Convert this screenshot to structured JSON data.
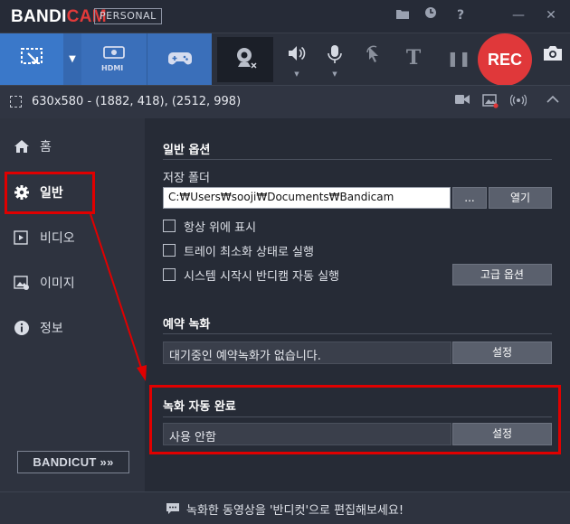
{
  "app": {
    "logo_main": "BANDI",
    "logo_accent": "CAM",
    "edition": "PERSONAL"
  },
  "titlebar": {
    "icons": [
      "folder-icon",
      "clock-icon",
      "help-icon",
      "minimize-icon",
      "close-icon"
    ],
    "minimize": "—",
    "close": "✕"
  },
  "toolbar": {
    "rec_label": "REC",
    "hdmi_label": "HDMI",
    "dd_arrow": "▼",
    "text_tool": "T",
    "pause": "❚❚"
  },
  "infobar": {
    "capture_info": "630x580 - (1882, 418), (2512, 998)"
  },
  "sidebar": {
    "items": [
      {
        "label": "홈",
        "icon": "home-icon"
      },
      {
        "label": "일반",
        "icon": "gear-icon"
      },
      {
        "label": "비디오",
        "icon": "video-icon"
      },
      {
        "label": "이미지",
        "icon": "image-icon"
      },
      {
        "label": "정보",
        "icon": "info-icon"
      }
    ],
    "bandicut_label": "BANDICUT »»"
  },
  "general": {
    "title": "일반 옵션",
    "folder_label": "저장 폴더",
    "folder_path": "C:₩Users₩sooji₩Documents₩Bandicam",
    "browse_label": "...",
    "open_label": "열기",
    "checkboxes": [
      {
        "label": "항상 위에 표시",
        "checked": false
      },
      {
        "label": "트레이 최소화 상태로 실행",
        "checked": false
      },
      {
        "label": "시스템 시작시 반디캠 자동 실행",
        "checked": false
      }
    ],
    "advanced_label": "고급 옵션"
  },
  "schedule": {
    "title": "예약 녹화",
    "status": "대기중인 예약녹화가 없습니다.",
    "settings_label": "설정"
  },
  "auto_complete": {
    "title": "녹화 자동 완료",
    "status": "사용 안함",
    "settings_label": "설정"
  },
  "footer": {
    "message": "녹화한 동영상을 '반디컷'으로 편집해보세요!"
  },
  "colors": {
    "accent": "#3a78c9",
    "rec": "#e0383a",
    "annotation": "#e00000"
  }
}
